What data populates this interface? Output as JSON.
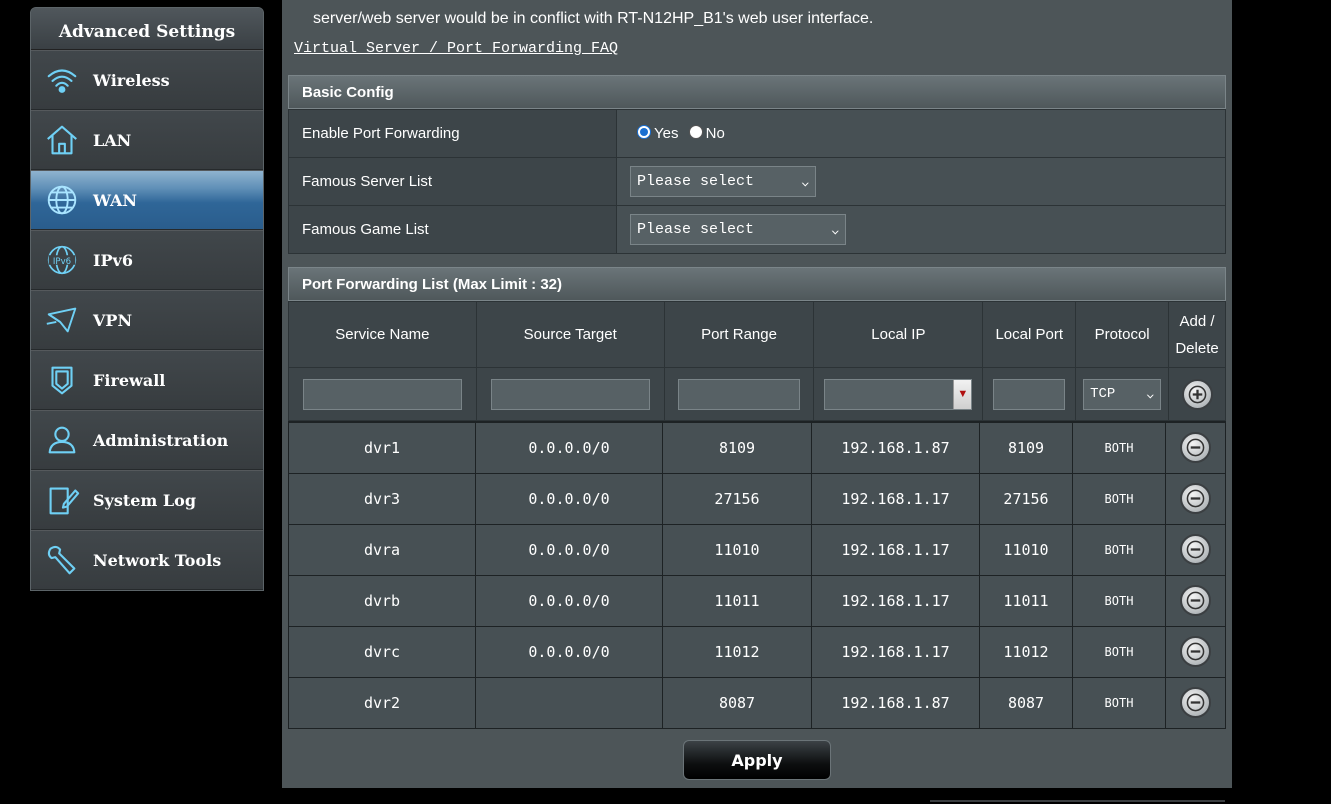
{
  "sidebar": {
    "title": "Advanced Settings",
    "items": [
      {
        "label": "Wireless",
        "icon": "wifi-icon",
        "active": false
      },
      {
        "label": "LAN",
        "icon": "home-icon",
        "active": false
      },
      {
        "label": "WAN",
        "icon": "globe-icon",
        "active": true
      },
      {
        "label": "IPv6",
        "icon": "ipv6-globe-icon",
        "active": false
      },
      {
        "label": "VPN",
        "icon": "vpn-icon",
        "active": false
      },
      {
        "label": "Firewall",
        "icon": "shield-icon",
        "active": false
      },
      {
        "label": "Administration",
        "icon": "admin-user-icon",
        "active": false
      },
      {
        "label": "System Log",
        "icon": "document-edit-icon",
        "active": false
      },
      {
        "label": "Network Tools",
        "icon": "wrench-icon",
        "active": false
      }
    ]
  },
  "main": {
    "description_line": "server/web server would be in conflict with RT-N12HP_B1's web user interface.",
    "faq_link": "Virtual Server / Port Forwarding FAQ"
  },
  "basic_config": {
    "title": "Basic Config",
    "enable_label": "Enable Port Forwarding",
    "yes_label": "Yes",
    "no_label": "No",
    "enabled": "Yes",
    "server_list_label": "Famous Server List",
    "server_list_value": "Please select",
    "game_list_label": "Famous Game List",
    "game_list_value": "Please select"
  },
  "pf_list": {
    "title": "Port Forwarding List (Max Limit : 32)",
    "headers": {
      "service_name": "Service Name",
      "source_target": "Source Target",
      "port_range": "Port Range",
      "local_ip": "Local IP",
      "local_port": "Local Port",
      "protocol": "Protocol",
      "add_delete_1": "Add /",
      "add_delete_2": "Delete"
    },
    "new_entry": {
      "protocol_value": "TCP"
    },
    "rows": [
      {
        "service": "dvr1",
        "source": "0.0.0.0/0",
        "port_range": "8109",
        "local_ip": "192.168.1.87",
        "local_port": "8109",
        "protocol": "BOTH"
      },
      {
        "service": "dvr3",
        "source": "0.0.0.0/0",
        "port_range": "27156",
        "local_ip": "192.168.1.17",
        "local_port": "27156",
        "protocol": "BOTH"
      },
      {
        "service": "dvra",
        "source": "0.0.0.0/0",
        "port_range": "11010",
        "local_ip": "192.168.1.17",
        "local_port": "11010",
        "protocol": "BOTH"
      },
      {
        "service": "dvrb",
        "source": "0.0.0.0/0",
        "port_range": "11011",
        "local_ip": "192.168.1.17",
        "local_port": "11011",
        "protocol": "BOTH"
      },
      {
        "service": "dvrc",
        "source": "0.0.0.0/0",
        "port_range": "11012",
        "local_ip": "192.168.1.17",
        "local_port": "11012",
        "protocol": "BOTH"
      },
      {
        "service": "dvr2",
        "source": "",
        "port_range": "8087",
        "local_ip": "192.168.1.87",
        "local_port": "8087",
        "protocol": "BOTH"
      }
    ]
  },
  "apply_label": "Apply",
  "colors": {
    "accent_active": "#2f6698",
    "panel_bg": "#4d5558",
    "radio_selected": "#1a6fd1"
  }
}
